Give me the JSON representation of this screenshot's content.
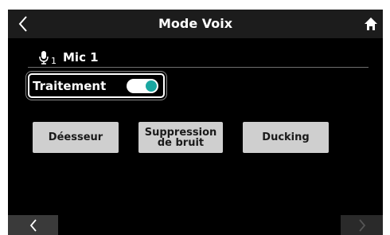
{
  "header": {
    "title": "Mode Voix",
    "back_icon": "chevron-left-icon",
    "home_icon": "home-icon"
  },
  "channel": {
    "icon": "microphone-icon",
    "number": "1",
    "name": "Mic 1"
  },
  "processing": {
    "label": "Traitement",
    "state": "on",
    "accent_color": "#1aa7a1"
  },
  "effects": {
    "deesser": "Déesseur",
    "noise_suppression": [
      "Suppression",
      "de bruit"
    ],
    "ducking": "Ducking"
  },
  "pagination": {
    "prev_icon": "chevron-left-icon",
    "next_icon": "chevron-right-icon"
  }
}
